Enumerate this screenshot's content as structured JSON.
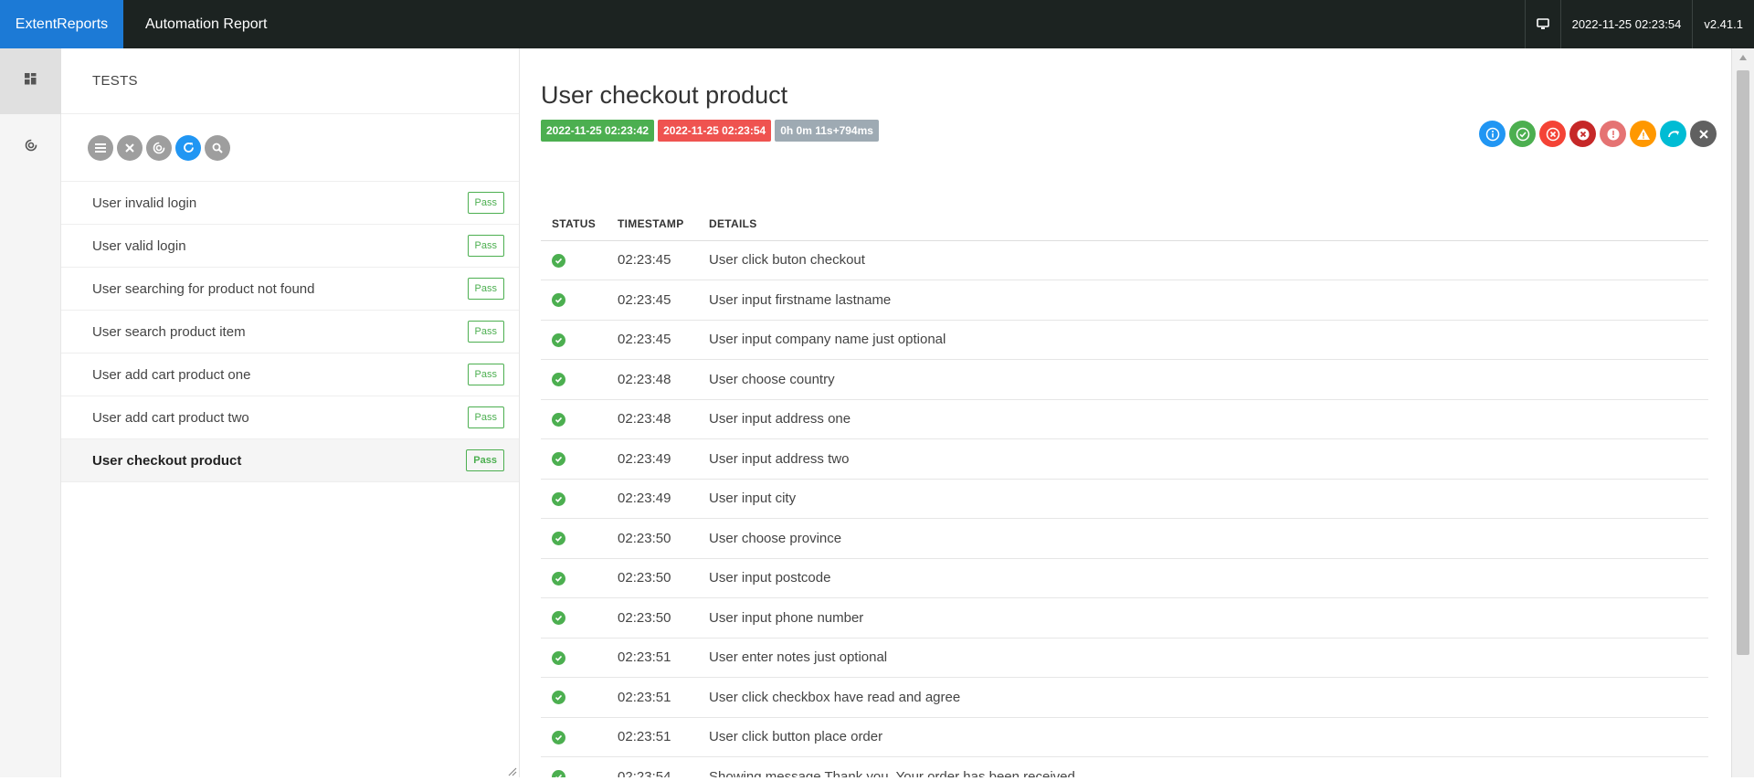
{
  "nav": {
    "brand": "ExtentReports",
    "report_name": "Automation Report",
    "timestamp": "2022-11-25 02:23:54",
    "version": "v2.41.1"
  },
  "sidebar": {
    "items": [
      {
        "icon": "dashboard-icon"
      },
      {
        "icon": "spinner-icon"
      }
    ]
  },
  "tests_panel": {
    "heading": "TESTS",
    "toolbar_icons": [
      "list-icon",
      "close-icon",
      "spinner-icon",
      "refresh-icon",
      "search-icon"
    ],
    "tests": [
      {
        "name": "User invalid login",
        "status": "Pass"
      },
      {
        "name": "User valid login",
        "status": "Pass"
      },
      {
        "name": "User searching for product not found",
        "status": "Pass"
      },
      {
        "name": "User search product item",
        "status": "Pass"
      },
      {
        "name": "User add cart product one",
        "status": "Pass"
      },
      {
        "name": "User add cart product two",
        "status": "Pass"
      },
      {
        "name": "User checkout product",
        "status": "Pass"
      }
    ]
  },
  "detail": {
    "title": "User checkout product",
    "start_time": "2022-11-25 02:23:42",
    "end_time": "2022-11-25 02:23:54",
    "duration": "0h 0m 11s+794ms",
    "status_filters": [
      {
        "icon": "info-icon",
        "color": "#2196f3"
      },
      {
        "icon": "pass-icon",
        "color": "#4caf50"
      },
      {
        "icon": "fail-icon",
        "color": "#f44336"
      },
      {
        "icon": "fatal-icon",
        "color": "#c62828"
      },
      {
        "icon": "error-icon",
        "color": "#e57373"
      },
      {
        "icon": "warning-icon",
        "color": "#ff9800"
      },
      {
        "icon": "skip-icon",
        "color": "#00bcd4"
      },
      {
        "icon": "clear-icon",
        "color": "#616161"
      }
    ],
    "columns": [
      "STATUS",
      "TIMESTAMP",
      "DETAILS"
    ],
    "logs": [
      {
        "time": "02:23:45",
        "details": "User click buton checkout"
      },
      {
        "time": "02:23:45",
        "details": "User input firstname lastname"
      },
      {
        "time": "02:23:45",
        "details": "User input company name just optional"
      },
      {
        "time": "02:23:48",
        "details": "User choose country"
      },
      {
        "time": "02:23:48",
        "details": "User input address one"
      },
      {
        "time": "02:23:49",
        "details": "User input address two"
      },
      {
        "time": "02:23:49",
        "details": "User input city"
      },
      {
        "time": "02:23:50",
        "details": "User choose province"
      },
      {
        "time": "02:23:50",
        "details": "User input postcode"
      },
      {
        "time": "02:23:50",
        "details": "User input phone number"
      },
      {
        "time": "02:23:51",
        "details": "User enter notes just optional"
      },
      {
        "time": "02:23:51",
        "details": "User click checkbox have read and agree"
      },
      {
        "time": "02:23:51",
        "details": "User click button place order"
      },
      {
        "time": "02:23:54",
        "details": "Showing message Thank you. Your order has been received"
      }
    ]
  }
}
